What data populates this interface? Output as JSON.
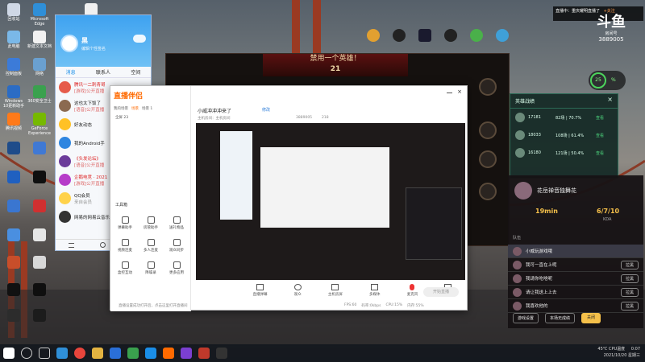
{
  "desktop_icons": [
    {
      "label": "回收站"
    },
    {
      "label": "Microsoft Edge"
    },
    {
      "label": "此电脑"
    },
    {
      "label": "新建文本文档"
    },
    {
      "label": "控制面板"
    },
    {
      "label": "网络"
    },
    {
      "label": "Windows 10更新助手"
    },
    {
      "label": "360安全卫士"
    },
    {
      "label": "腾讯视频"
    },
    {
      "label": "GeForce Experience"
    }
  ],
  "taskbar": {
    "tray_temp": "45℃",
    "tray_cpu": "CPU温度",
    "time": "0:07",
    "date": "2021/10/20 星期三"
  },
  "qq": {
    "user": "黑",
    "signature": "编辑个性签名",
    "tabs": [
      "消息",
      "联系人",
      "空间"
    ],
    "items": [
      {
        "title": "腾讯一二刺青哥",
        "sub": "[游戏]公开直播"
      },
      {
        "title": "这也太下饭了",
        "sub": "[语音]公开直播"
      },
      {
        "title": "好友动态",
        "sub": ""
      },
      {
        "title": "我的Android手",
        "sub": ""
      },
      {
        "title": "《头发论坛》",
        "sub": "[语音]公开直播"
      },
      {
        "title": "企鹅电竞 · 2021",
        "sub": "[游戏]公开直播"
      },
      {
        "title": "QQ会员",
        "sub": "来自会员"
      },
      {
        "title": "网易的网易云音乐",
        "sub": ""
      }
    ]
  },
  "game": {
    "banner_title": "禁用一个英雄！",
    "timer": "21"
  },
  "studio": {
    "logo": "直播伴侣",
    "scene_tabs": [
      "我的场景",
      "场景",
      "场景 1"
    ],
    "scene_label": "全屏 23",
    "room_title": "小威冲冲冲来了",
    "room_link": "修改",
    "room_meta": "主机房间：主机房间",
    "room_id": "3889005",
    "viewers": "218",
    "tools_title": "工具箱",
    "tools": [
      {
        "label": "弹幕助手"
      },
      {
        "label": "房管助手"
      },
      {
        "label": "送礼物品"
      },
      {
        "label": "视频连麦"
      },
      {
        "label": "多人连麦"
      },
      {
        "label": "观众同步"
      },
      {
        "label": "盒控互动"
      },
      {
        "label": "降噪录"
      },
      {
        "label": "更多应用"
      }
    ],
    "bottom_tools": [
      {
        "label": "直播弹幕"
      },
      {
        "label": "观众"
      },
      {
        "label": "主机房屏"
      },
      {
        "label": "多媒体"
      },
      {
        "label": "麦克风"
      },
      {
        "label": "音乐"
      }
    ],
    "start_button": "开始直播",
    "status_text": "直播设置成功打开后，点击这里打开直播间",
    "stats": [
      "FPS:60",
      "码率:0kbps",
      "CPU:15%",
      "内存:55%"
    ]
  },
  "topr": {
    "line1": "直播中：重庆耀明直播了",
    "line2": "+关注"
  },
  "logo_badge": {
    "name": "斗鱼",
    "sub": "房间号",
    "room": "3889005"
  },
  "cpu_widget": {
    "value": "25",
    "unit": "%"
  },
  "gamepanel": {
    "title": "英雄战绩",
    "rows": [
      {
        "id": "17181",
        "stat": "82场 | 70.7%",
        "action": "查看"
      },
      {
        "id": "18033",
        "stat": "108场 | 61.4%",
        "action": "查看"
      },
      {
        "id": "16180",
        "stat": "121场 | 50.4%",
        "action": "查看"
      }
    ]
  },
  "teampanel": {
    "title": "花岳禅音独舞花",
    "time": "19min",
    "score": "6/7/10",
    "score_label": "KDA",
    "section": "队伍",
    "rows": [
      {
        "name": "小威玩游戏哦",
        "action": ""
      },
      {
        "name": "我可一直在上呢",
        "action": "拉黑"
      },
      {
        "name": "我请你吃啥呢",
        "action": "拉黑"
      },
      {
        "name": "请让我送上上去",
        "action": "拉黑"
      },
      {
        "name": "我喜欢他的",
        "action": "拉黑"
      }
    ],
    "buttons": [
      "游戏设置",
      "本场无成绩",
      "关闭"
    ]
  }
}
